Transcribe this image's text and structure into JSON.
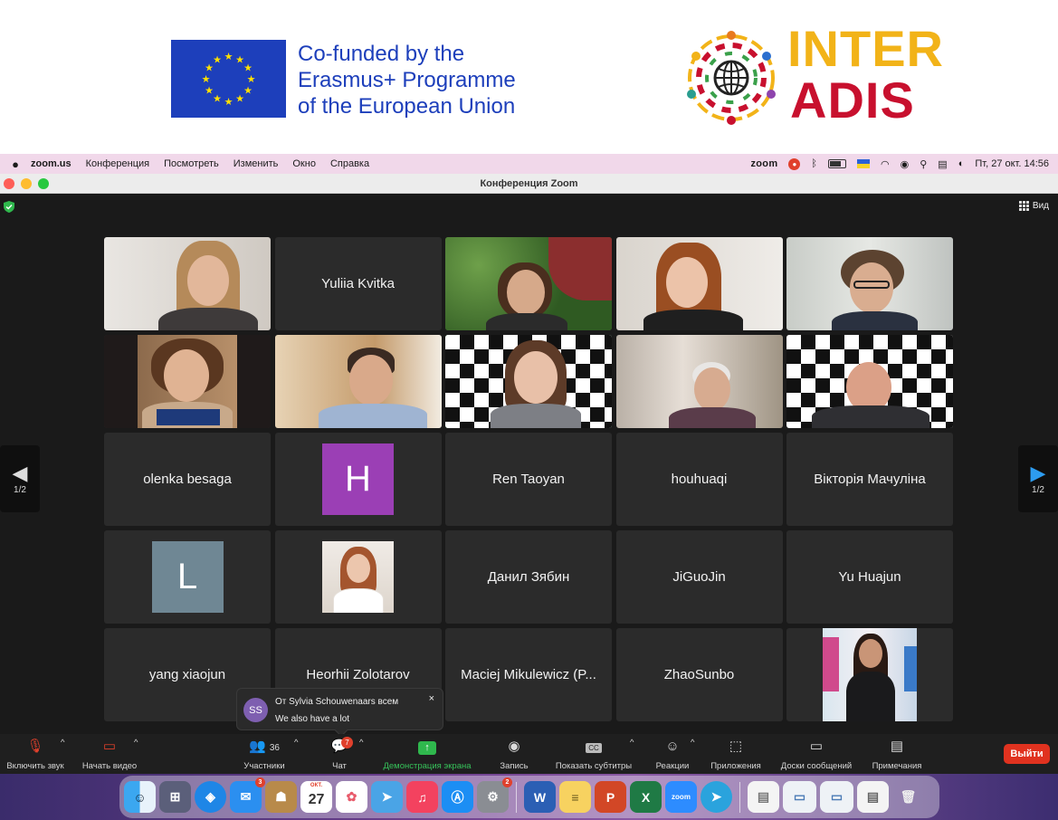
{
  "banner": {
    "eu_text": [
      "Co-funded by the",
      "Erasmus+ Programme",
      "of the European Union"
    ],
    "logo_line1": "INTER",
    "logo_line2": "ADIS"
  },
  "menubar": {
    "app": "zoom.us",
    "items": [
      "Конференция",
      "Посмотреть",
      "Изменить",
      "Окно",
      "Справка"
    ],
    "zoom_word": "zoom",
    "clock": "Пт, 27 окт.  14:56"
  },
  "window": {
    "title": "Конференция Zoom",
    "view_label": "Вид"
  },
  "pager": {
    "left": "1/2",
    "right": "1/2"
  },
  "tiles": [
    {
      "name": "",
      "kind": "video"
    },
    {
      "name": "Yuliia Kvitka",
      "kind": "name"
    },
    {
      "name": "",
      "kind": "video"
    },
    {
      "name": "",
      "kind": "video"
    },
    {
      "name": "",
      "kind": "video"
    },
    {
      "name": "",
      "kind": "video"
    },
    {
      "name": "",
      "kind": "video"
    },
    {
      "name": "",
      "kind": "video",
      "active": true
    },
    {
      "name": "",
      "kind": "video"
    },
    {
      "name": "",
      "kind": "video"
    },
    {
      "name": "olenka besaga",
      "kind": "name"
    },
    {
      "name": "H",
      "kind": "letter"
    },
    {
      "name": "Ren Taoyan",
      "kind": "name"
    },
    {
      "name": "houhuaqi",
      "kind": "name"
    },
    {
      "name": "Вікторія Мачуліна",
      "kind": "name"
    },
    {
      "name": "L",
      "kind": "letter"
    },
    {
      "name": "",
      "kind": "photo"
    },
    {
      "name": "Данил Зябин",
      "kind": "name"
    },
    {
      "name": "JiGuoJin",
      "kind": "name"
    },
    {
      "name": "Yu Huajun",
      "kind": "name"
    },
    {
      "name": "yang xiaojun",
      "kind": "name"
    },
    {
      "name": "Heorhii Zolotarov",
      "kind": "name"
    },
    {
      "name": "Maciej Mikulewicz (P...",
      "kind": "name"
    },
    {
      "name": "ZhaoSunbo",
      "kind": "name"
    },
    {
      "name": "",
      "kind": "photo"
    }
  ],
  "toast": {
    "initials": "SS",
    "from": "От Sylvia Schouwenaars всем",
    "message": "We also have a lot",
    "close": "×"
  },
  "toolbar": {
    "mute": "Включить звук",
    "video": "Начать видео",
    "participants": "Участники",
    "participants_count": "36",
    "chat": "Чат",
    "chat_badge": "7",
    "share": "Демонстрация экрана",
    "record": "Запись",
    "captions": "Показать субтитры",
    "captions_icon": "CC",
    "reactions": "Реакции",
    "apps": "Приложения",
    "whiteboards": "Доски сообщений",
    "notes": "Примечания",
    "leave": "Выйти"
  },
  "dock": {
    "calendar_month": "ОКТ.",
    "calendar_day": "27",
    "mail_badge": "3",
    "settings_badge": "2",
    "zoom_label": "zoom"
  },
  "colors": {
    "eu_blue": "#1d3fbb",
    "inter_yellow": "#f2b318",
    "adis_red": "#c8102e",
    "active_speaker": "#3ac05a",
    "leave_red": "#e0321f"
  }
}
